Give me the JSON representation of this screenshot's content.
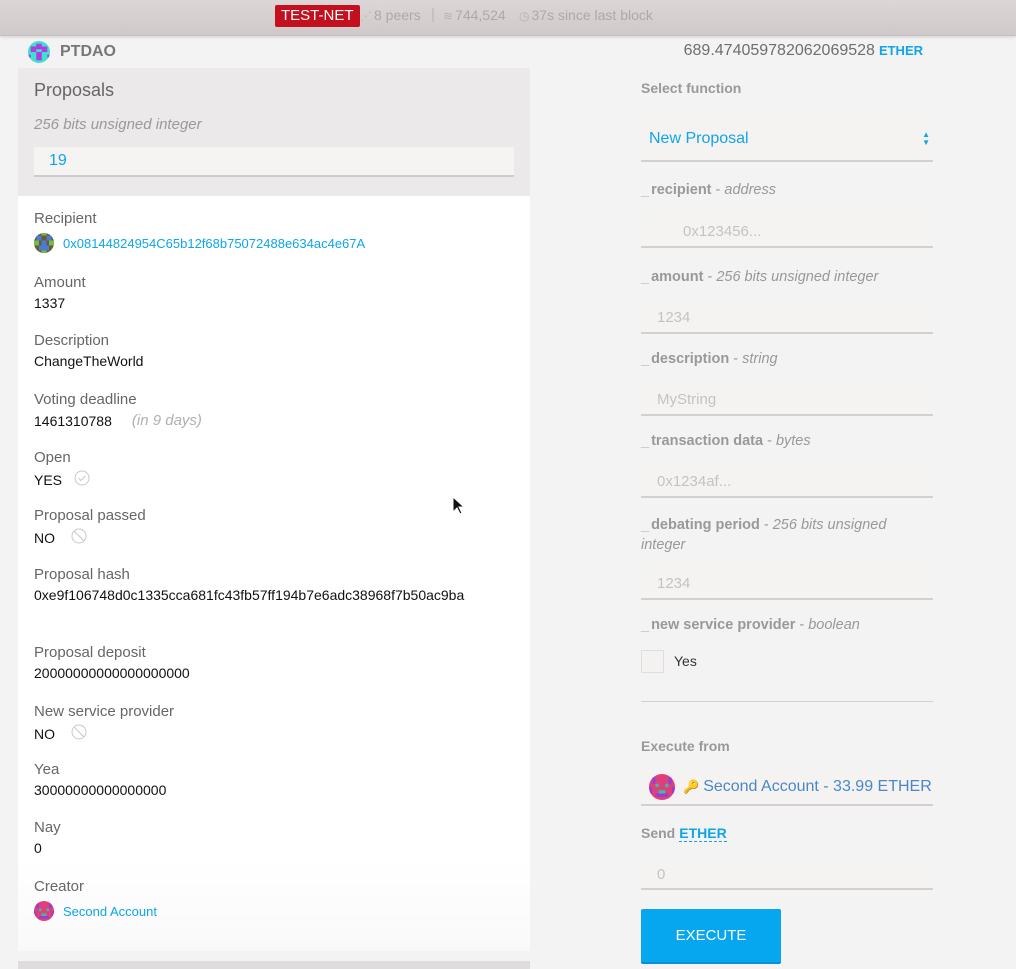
{
  "topbar": {
    "network_badge": "TEST-NET",
    "peers": "8 peers",
    "separator": "|",
    "block_number": "744,524",
    "last_block": "37s since last block",
    "colors": {
      "badge": "#c4101e"
    }
  },
  "contract": {
    "name": "PTDAO",
    "balance": "689.474059782062069528",
    "balance_unit": "ETHER"
  },
  "proposals": {
    "title": "Proposals",
    "type": "256 bits unsigned integer",
    "index_value": "19"
  },
  "details": {
    "recipient_label": "Recipient",
    "recipient_address": "0x08144824954C65b12f68b75072488e634ac4e67A",
    "amount_label": "Amount",
    "amount_value": "1337",
    "description_label": "Description",
    "description_value": "ChangeTheWorld",
    "deadline_label": "Voting deadline",
    "deadline_value": "1461310788",
    "deadline_relative": "(in 9 days)",
    "open_label": "Open",
    "open_value": "YES",
    "passed_label": "Proposal passed",
    "passed_value": "NO",
    "hash_label": "Proposal hash",
    "hash_value": "0xe9f106748d0c1335cca681fc43fb57ff194b7e6adc38968f7b50ac9ba",
    "deposit_label": "Proposal deposit",
    "deposit_value": "20000000000000000000",
    "nsp_label": "New service provider",
    "nsp_value": "NO",
    "yea_label": "Yea",
    "yea_value": "30000000000000000",
    "nay_label": "Nay",
    "nay_value": "0",
    "creator_label": "Creator",
    "creator_value": "Second Account"
  },
  "function_form": {
    "select_label": "Select function",
    "selected_function": "New Proposal",
    "params": [
      {
        "name": "recipient",
        "type": "address",
        "placeholder": "0x123456..."
      },
      {
        "name": "amount",
        "type": "256 bits unsigned integer",
        "placeholder": "1234"
      },
      {
        "name": "description",
        "type": "string",
        "placeholder": "MyString"
      },
      {
        "name": "transaction data",
        "type": "bytes",
        "placeholder": "0x1234af..."
      },
      {
        "name": "debating period",
        "type": "256 bits unsigned integer",
        "placeholder": "1234"
      },
      {
        "name": "new service provider",
        "type": "boolean"
      }
    ],
    "param_prefix": "_",
    "param_dash": " - ",
    "checkbox_label": "Yes",
    "execute_from_label": "Execute from",
    "execute_from_account": "Second Account - 33.99 ETHER",
    "send_label": "Send",
    "send_unit": "ETHER",
    "send_placeholder": "0",
    "execute_button": "EXECUTE"
  }
}
